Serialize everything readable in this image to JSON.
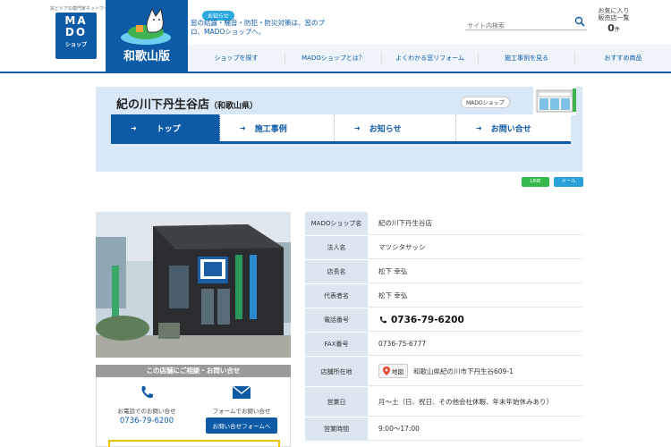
{
  "header": {
    "logo_tagline": "窓とドアの専門家ネットワーク",
    "logo_text": "MADO",
    "logo_sub": "ショップ",
    "region": "和歌山版",
    "notice_badge": "お知らせ",
    "notice_text": "窓の結露・騒音・防犯・防災対策は、窓のプロ、MADOショップへ。",
    "search_placeholder": "サイト内検索",
    "favorites_label": "お気に入り\n販売店一覧",
    "favorites_count": "0",
    "favorites_unit": "件"
  },
  "nav": {
    "items": [
      {
        "label": "ショップを探す"
      },
      {
        "label": "MADOショップとは？"
      },
      {
        "label": "よくわかる窓リフォーム"
      },
      {
        "label": "施工事例を見る"
      },
      {
        "label": "おすすめ商品"
      }
    ]
  },
  "shop": {
    "name": "紀の川下丹生谷店",
    "pref": "（和歌山県）",
    "tag": "MADOショップ",
    "tabs": [
      {
        "label": "トップ"
      },
      {
        "label": "施工事例"
      },
      {
        "label": "お知らせ"
      },
      {
        "label": "お問い合せ"
      }
    ]
  },
  "share": {
    "line": "LINE",
    "mail": "メール"
  },
  "contact": {
    "bar": "この店舗にご相談・お問い合せ",
    "phone_label": "お電話でのお問い合せ",
    "phone": "0736-79-6200",
    "form_label": "フォームでお問い合せ",
    "form_button": "お問い合せフォームへ"
  },
  "info": {
    "rows": [
      {
        "k": "MADOショップ名",
        "v": "紀の川下丹生谷店"
      },
      {
        "k": "法人名",
        "v": "マツシタサッシ"
      },
      {
        "k": "店長名",
        "v": "松下 幸弘"
      },
      {
        "k": "代表者名",
        "v": "松下 幸弘"
      },
      {
        "k": "電話番号",
        "v": "0736-79-6200"
      },
      {
        "k": "FAX番号",
        "v": "0736-75-6777"
      },
      {
        "k": "店舗所在地",
        "v": "和歌山県紀の川市下丹生谷609-1",
        "map": "地図"
      },
      {
        "k": "営業日",
        "v": "月～土（日、祝日、その他会社休暇、年末年始休みあり）"
      },
      {
        "k": "営業時間",
        "v": "9:00～17:00"
      }
    ]
  },
  "colors": {
    "brand": "#0d5aa7",
    "header_bg": "#d9e8f6",
    "line_green": "#35b94a"
  }
}
